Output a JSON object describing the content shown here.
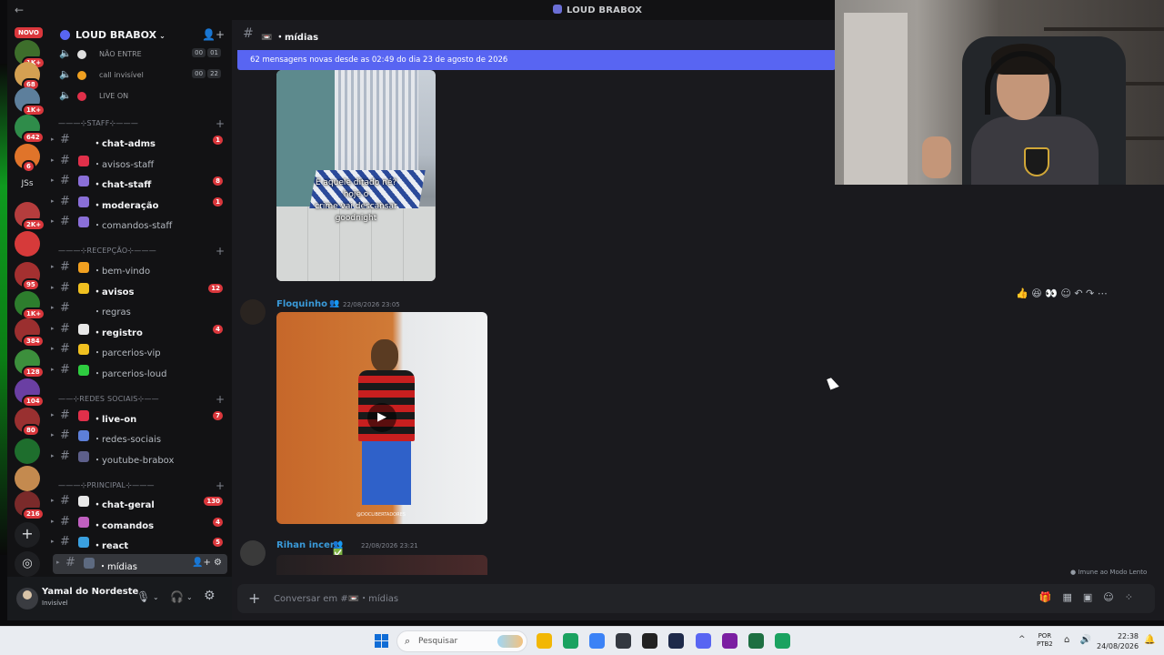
{
  "titlebar": {
    "back": "←",
    "title": "LOUD BRABOX"
  },
  "rail": {
    "novo": "NOVO",
    "servers": [
      {
        "badge": "1K+",
        "color": "#3d6e2b"
      },
      {
        "badge": "68",
        "color": "#d4a052"
      },
      {
        "badge": "1K+",
        "color": "#5d7f9c"
      },
      {
        "badge": "642",
        "color": "#2f8c4a"
      },
      {
        "badge": "6",
        "color": "#e0742a"
      },
      {
        "badge": "",
        "label": "JSs",
        "color": "#1e1f22"
      },
      {
        "badge": "2K+",
        "color": "#b53d3d"
      },
      {
        "badge": "",
        "color": "#d63a3a"
      },
      {
        "badge": "95",
        "color": "#a43030"
      },
      {
        "badge": "1K+",
        "color": "#2d7d2d"
      },
      {
        "badge": "384",
        "color": "#9b2f2f"
      },
      {
        "badge": "128",
        "color": "#3c8f3c"
      },
      {
        "badge": "104",
        "color": "#6a3fa3"
      },
      {
        "badge": "80",
        "color": "#993030"
      },
      {
        "badge": "",
        "color": "#1e6e2d"
      },
      {
        "badge": "",
        "color": "#c48a4f"
      },
      {
        "badge": "216",
        "color": "#7a2a2a"
      }
    ],
    "add": "+",
    "discover": "◎"
  },
  "server": {
    "name": "LOUD BRABOX",
    "chevron": "⌄",
    "invite_icon": "👤+"
  },
  "voice": [
    {
      "label": "NÃO ENTRE",
      "emoji_color": "#e0e0e0",
      "a": "00",
      "b": "01"
    },
    {
      "label": "call invisível",
      "emoji_color": "#f0a020",
      "a": "00",
      "b": "22"
    },
    {
      "label": "LIVE ON",
      "emoji_color": "#e0304a",
      "a": "",
      "b": ""
    }
  ],
  "categories": {
    "staff": "———⊹STAFF⊹———",
    "recepcao": "———⊹RECEPÇÃO⊹———",
    "redes": "——⊹REDES SOCIAIS⊹——",
    "principal": "———⊹PRINCIPAL⊹———"
  },
  "channels": [
    {
      "label": "chat-adms",
      "count": "1",
      "emoji_color": ""
    },
    {
      "label": "avisos-staff",
      "count": "",
      "emoji_color": "#e0304a"
    },
    {
      "label": "chat-staff",
      "count": "8",
      "emoji_color": "#8a6fd8"
    },
    {
      "label": "moderação",
      "count": "1",
      "emoji_color": "#8a6fd8"
    },
    {
      "label": "comandos-staff",
      "count": "",
      "emoji_color": "#8a6fd8"
    },
    {
      "label": "bem-vindo",
      "count": "",
      "emoji_color": "#f0a020"
    },
    {
      "label": "avisos",
      "count": "12",
      "emoji_color": "#f0c020"
    },
    {
      "label": "regras",
      "count": "",
      "emoji_color": ""
    },
    {
      "label": "registro",
      "count": "4",
      "emoji_color": "#e8e8e8"
    },
    {
      "label": "parcerios-vip",
      "count": "",
      "emoji_color": "#f0c020"
    },
    {
      "label": "parcerios-loud",
      "count": "",
      "emoji_color": "#2ecc40"
    },
    {
      "label": "live-on",
      "count": "7",
      "emoji_color": "#e0304a"
    },
    {
      "label": "redes-sociais",
      "count": "",
      "emoji_color": "#5d7fd8"
    },
    {
      "label": "youtube-brabox",
      "count": "",
      "emoji_color": "#5d5f8a"
    },
    {
      "label": "chat-geral",
      "count": "130",
      "emoji_color": "#e8e8e8"
    },
    {
      "label": "comandos",
      "count": "4",
      "emoji_color": "#c060c0"
    },
    {
      "label": "react",
      "count": "5",
      "emoji_color": "#3aa0e0"
    },
    {
      "label": "mídias",
      "count": "",
      "emoji_color": "#5d6a80"
    }
  ],
  "active_icons": "👤+ ⚙",
  "user": {
    "name": "Yamal do Nordeste",
    "status": "Invisível",
    "mic": "🎙",
    "headset": "🎧",
    "settings": "⚙"
  },
  "chat": {
    "hash": "#",
    "channel": "mídias",
    "new_banner": "62 mensagens novas desde as 02:49 do dia 23 de agosto de 2026",
    "image_caption": "E aquele ditado né?\nhoje o\ncrime vai descansar\ngoodnight",
    "messages": [
      {
        "author": "Floquinho",
        "time": "22/08/2026 23:05"
      },
      {
        "author": "Rihan incerti",
        "time": "22/08/2026 23:21"
      }
    ],
    "video_watermark": "@DOCLIBERTADORES",
    "play": "▶",
    "slow_mode": "Imune ao Modo Lento",
    "composer_placeholder": "Conversar em #📼・mídias",
    "composer_tools": "🎁▦▣☺⁘",
    "reactions": "👍 😆 👀 ☺ ↶ ↷ ⋯"
  },
  "taskbar": {
    "search": "Pesquisar",
    "lang_top": "POR",
    "lang_bottom": "PTB2",
    "time": "22:38",
    "date": "24/08/2026",
    "tray": "^",
    "sys": "⌂ 🔊",
    "bell": "🔔",
    "apps": [
      "#f2b705",
      "#1aa260",
      "#3b82f6",
      "#333840",
      "#222",
      "#1e2a4a",
      "#5865f2",
      "#7b1fa2",
      "#1d6f42",
      "#1aa260"
    ]
  }
}
